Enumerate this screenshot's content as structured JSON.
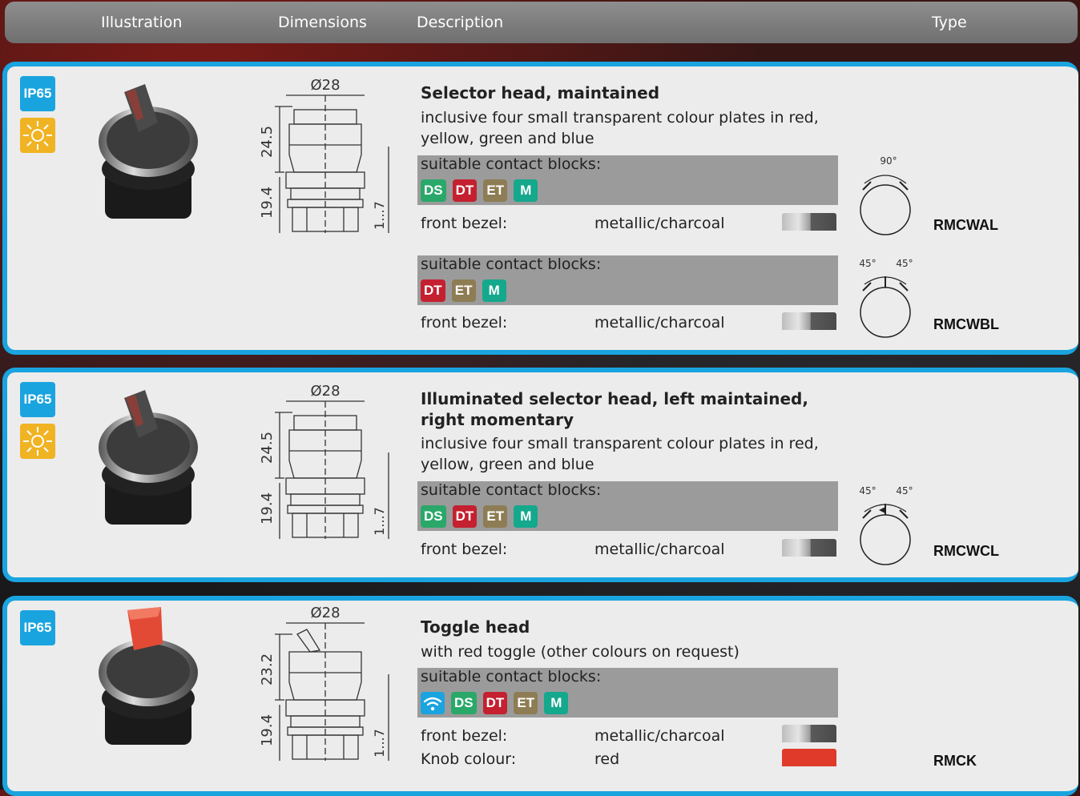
{
  "header": {
    "illustration": "Illustration",
    "dimensions": "Dimensions",
    "description": "Description",
    "type": "Type"
  },
  "labels": {
    "ip": "IP65",
    "contact_blocks": "suitable contact blocks:",
    "front_bezel": "front bezel:",
    "bezel_value": "metallic/charcoal",
    "knob_colour": "Knob colour:",
    "knob_value": "red",
    "dim_dia": "Ø28",
    "dim_19_4": "19.4",
    "dim_1_7": "1...7",
    "deg90": "90°",
    "deg45": "45°"
  },
  "chips": {
    "DS": "DS",
    "DT": "DT",
    "ET": "ET",
    "M": "M"
  },
  "colors": {
    "DS": "#2aa86a",
    "DT": "#c4202f",
    "ET": "#8e7d54",
    "M": "#14a88d",
    "wifi": "#1aa4df",
    "accent": "#1aa4df"
  },
  "products": [
    {
      "title": "Selector head, maintained",
      "description": "inclusive four small transparent colour plates in red, yellow, green and blue",
      "dim_top": "24.5",
      "variants": [
        {
          "type": "RMCWAL"
        },
        {
          "type": "RMCWBL"
        }
      ]
    },
    {
      "title_line1": "Illuminated selector head, left maintained,",
      "title_line2": "right momentary",
      "description": "inclusive four small transparent colour plates in red, yellow, green and blue",
      "dim_top": "24.5",
      "type": "RMCWCL"
    },
    {
      "title": "Toggle head",
      "description": "with red toggle (other colours on request)",
      "dim_top": "23.2",
      "type": "RMCK"
    }
  ]
}
